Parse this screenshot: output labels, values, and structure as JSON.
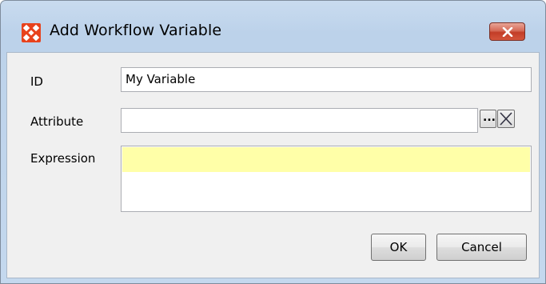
{
  "window": {
    "title": "Add Workflow Variable",
    "close_icon": "close-icon",
    "app_icon": "app-logo-icon",
    "accent_color": "#e8421c"
  },
  "form": {
    "id_label": "ID",
    "id_value": "My Variable",
    "attribute_label": "Attribute",
    "attribute_value": "",
    "browse_label": "...",
    "clear_icon": "clear-icon",
    "expression_label": "Expression",
    "expression_value": "",
    "expression_highlight_color": "#ffffa8"
  },
  "buttons": {
    "ok_label": "OK",
    "cancel_label": "Cancel"
  }
}
